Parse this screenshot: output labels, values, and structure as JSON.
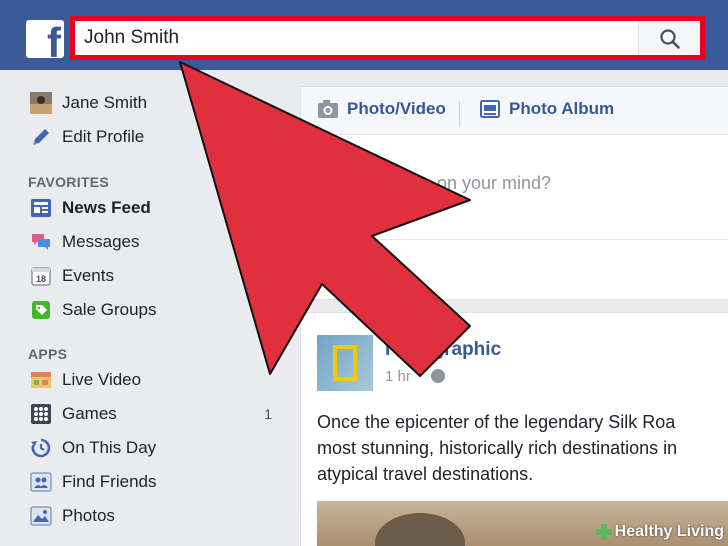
{
  "topbar": {
    "logo_letter": "f",
    "search_value": "John Smith",
    "brand_color": "#3b5998",
    "highlight_color": "#e8001c"
  },
  "sidebar": {
    "profile": {
      "name": "Jane Smith",
      "edit": "Edit Profile"
    },
    "favorites_title": "FAVORITES",
    "favorites": [
      {
        "label": "News Feed",
        "icon": "news-feed-icon"
      },
      {
        "label": "Messages",
        "icon": "messages-icon"
      },
      {
        "label": "Events",
        "icon": "calendar-icon",
        "icon_text": "18"
      },
      {
        "label": "Sale Groups",
        "icon": "sale-tag-icon"
      }
    ],
    "apps_title": "APPS",
    "apps": [
      {
        "label": "Live Video",
        "icon": "live-video-icon"
      },
      {
        "label": "Games",
        "icon": "games-icon",
        "count": "1"
      },
      {
        "label": "On This Day",
        "icon": "on-this-day-icon"
      },
      {
        "label": "Find Friends",
        "icon": "find-friends-icon"
      },
      {
        "label": "Photos",
        "icon": "photos-icon"
      }
    ]
  },
  "composer": {
    "tab_photo_video": "Photo/Video",
    "tab_photo_album": "Photo Album",
    "prompt_visible": "on your mind?"
  },
  "post": {
    "page_name_visible": "l Geographic",
    "time_visible": "1 hr",
    "text_lines": [
      "Once the epicenter of the legendary Silk Roa",
      "most stunning, historically rich destinations in",
      "atypical travel destinations."
    ]
  },
  "overlay": {
    "arrow_color": "#e0303e",
    "watermark": "Healthy Living"
  }
}
